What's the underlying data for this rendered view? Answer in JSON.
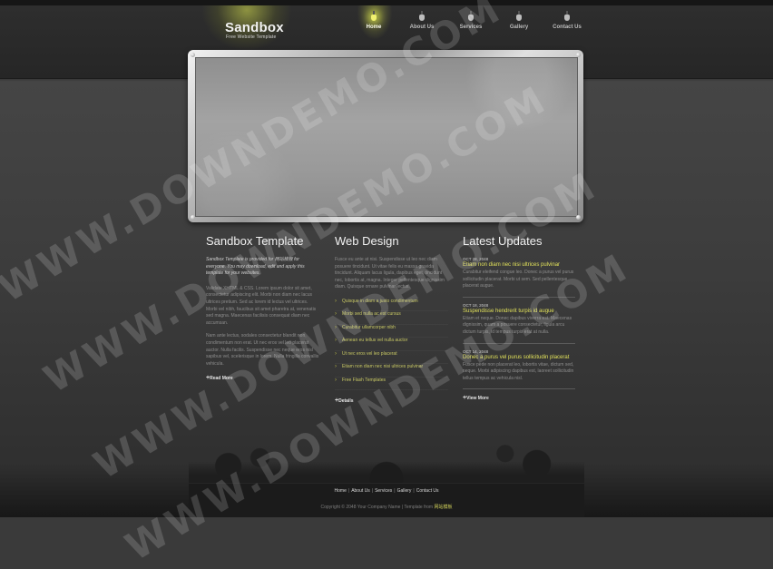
{
  "brand": {
    "title": "Sandbox",
    "subtitle": "Free Website Template"
  },
  "nav": {
    "items": [
      {
        "label": "Home",
        "active": true
      },
      {
        "label": "About Us",
        "active": false
      },
      {
        "label": "Services",
        "active": false
      },
      {
        "label": "Gallery",
        "active": false
      },
      {
        "label": "Contact Us",
        "active": false
      }
    ]
  },
  "col1": {
    "title": "Sandbox Template",
    "lead": "Sandbox Template is provided for 网站模板 for everyone. You may download, edit and apply this template for your websites.",
    "para1": "Validate XHTML & CSS. Lorem ipsum dolor sit amet, consectetur adipiscing elit. Morbi non diam nec lacus ultrices pretium. Sed ac lorem id lectus vel ultrices. Morbi vel nibh, faucibus sit amet pharetra at, venenatis sed magna. Maecenas facilisis consequat diam nec accumsan.",
    "para2": "Nam ante lectus, sodales consectetur blandit non, condimentum non erat. Ut nec eros vel leo placerat auctor. Nulla facilis. Suspendisse nec neque eros nisl sapibus vel, scelerisque in lorem. Nulla fringilla convallis vehicula.",
    "more": "Read More"
  },
  "col2": {
    "title": "Web Design",
    "intro": "Fusce eu ante at nisi. Suspendisse ut leo nec diam posuere tincidunt. Ut vitae felis eu massa gravida tincidunt. Aliquam lacus ligula, dapibus eget, tincidunt nec, lobortis at, magna. Integer pellentesque dignissim diam. Quisque ornare pulvinar lectus.",
    "list": [
      "Quisque in diam a justo condimentum",
      "Morbi sed nulla ac est cursus",
      "Curabitur ullamcorper nibh",
      "Aenean eu tellus vel nulla auctor",
      "Ut nec eros vel leo placerat",
      "Etiam non diam nec nisi ultrices pulvinar",
      "Free Flash Templates"
    ],
    "more": "Details"
  },
  "col3": {
    "title": "Latest Updates",
    "updates": [
      {
        "date": "OCT 28, 2048",
        "title": "Etiam non diam nec nisi ultrices pulvinar",
        "text": "Curabitur eleifend congue leo. Donec a purus vel purus sollicitudin placerat. Morbi ut sem. Sed pellentesque placerat augue."
      },
      {
        "date": "OCT 18, 2048",
        "title": "Suspendisse hendrerit turpis id augue",
        "text": "Etiam et neque. Donec dapibus viverra est. Maecenas dignissim, quam a posuere consectetur, ligula arcu dictum turpis, id tempus turpis erat at nulla."
      },
      {
        "date": "OCT 14, 2048",
        "title": "Donec a purus vel purus sollicitudin placerat",
        "text": "Fusce pede non placerat leo, lobortis vitae, dictum sed, neque. Morbi adipiscing dapibus est, laoreet sollicitudin tellus tempus ac vehicula nisl."
      }
    ],
    "more": "View More"
  },
  "footer": {
    "links": [
      "Home",
      "About Us",
      "Services",
      "Gallery",
      "Contact Us"
    ],
    "copyright_prefix": "Copyright © 2048 Your Company Name | Template from ",
    "copyright_site": "网站模板"
  },
  "watermark": {
    "text": "WWW.DOWNDEMO.COM"
  }
}
